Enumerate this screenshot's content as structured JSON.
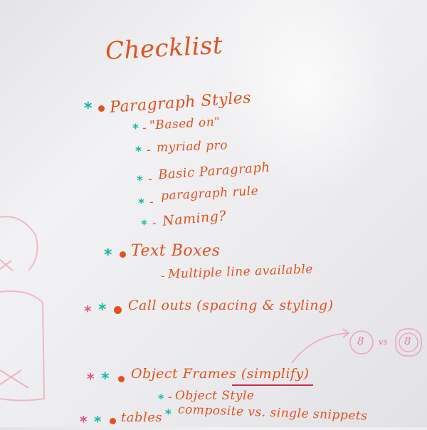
{
  "whiteboard": {
    "title": "Checklist",
    "items": [
      {
        "text": "Paragraph Styles",
        "sub": [
          "\"Based on\"",
          "myriad pro",
          "Basic Paragraph",
          "paragraph rule",
          "Naming?"
        ]
      },
      {
        "text": "Text Boxes",
        "sub": [
          "Multiple line available"
        ]
      },
      {
        "text": "Call outs (spacing & styling)",
        "sub": []
      },
      {
        "text": "Object Frames (simplify)",
        "sub": [
          "Object Style",
          "composite vs. single snippets"
        ]
      },
      {
        "text": "tables",
        "sub": []
      }
    ],
    "diagram": {
      "left_label": "8",
      "joiner": "vs",
      "right_label": "8"
    }
  }
}
